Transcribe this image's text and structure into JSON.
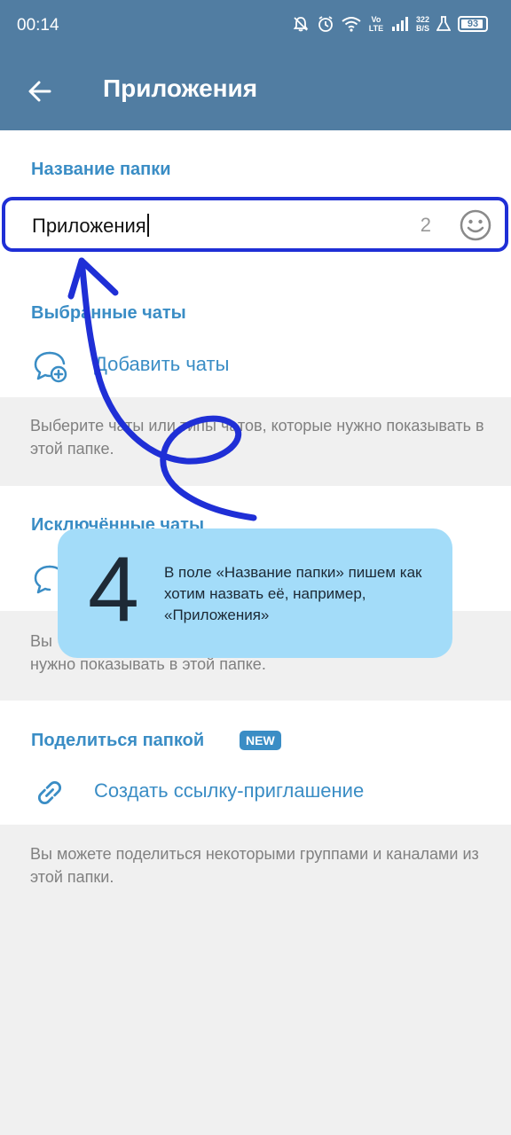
{
  "status_bar": {
    "time": "00:14",
    "network": "Vo LTE",
    "speed_value": "322",
    "speed_unit": "B/S",
    "battery": "93",
    "battery_level": 0.93
  },
  "toolbar": {
    "title": "Приложения"
  },
  "folder_name": {
    "header": "Название папки",
    "value": "Приложения",
    "counter": "2"
  },
  "included": {
    "header": "Выбранные чаты",
    "add_label": "Добавить чаты",
    "hint": "Выберите чаты или типы чатов, которые нужно показывать в этой папке."
  },
  "excluded": {
    "header": "Исключённые чаты",
    "hint_start": "Вы",
    "hint_line2": "нужно показывать в этой папке."
  },
  "share": {
    "header": "Поделиться папкой",
    "badge": "NEW",
    "link_label": "Создать ссылку-приглашение",
    "hint": "Вы можете поделиться некоторыми группами и каналами из этой папки."
  },
  "annotation": {
    "step_number": "4",
    "text": "В поле «Название папки» пишем как хотим назвать её, например, «Приложения»"
  },
  "colors": {
    "header_bar": "#517da2",
    "accent": "#3a8dc5",
    "annotation_pen": "#1f2fd6",
    "tip_card": "#a3dcf9"
  }
}
